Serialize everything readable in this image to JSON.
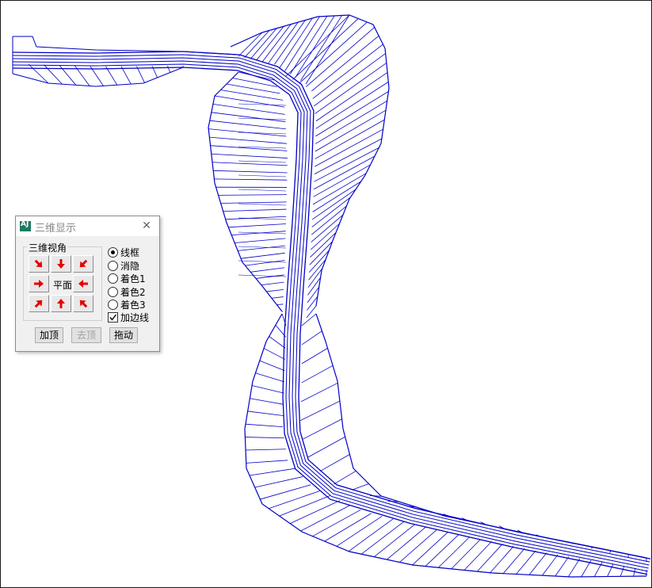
{
  "window": {
    "title": "三维显示",
    "app_icon": "app-icon",
    "close_glyph": "✕"
  },
  "view_group": {
    "label": "三维视角",
    "center_label": "平面",
    "arrows": [
      "arrow-down-right",
      "arrow-down",
      "arrow-down-left",
      "arrow-right",
      "arrow-left",
      "arrow-up-right",
      "arrow-up",
      "arrow-up-left"
    ]
  },
  "display_modes": [
    {
      "label": "线框",
      "selected": true
    },
    {
      "label": "消隐",
      "selected": false
    },
    {
      "label": "着色1",
      "selected": false
    },
    {
      "label": "着色2",
      "selected": false
    },
    {
      "label": "着色3",
      "selected": false
    }
  ],
  "edge_lines": {
    "label": "加边线",
    "checked": true
  },
  "buttons": {
    "add_top": "加顶",
    "remove_top": "去顶",
    "drag": "拖动"
  },
  "colors": {
    "wireframe": "#0000c8",
    "arrow": "#e60000",
    "icon": "#1e7a63"
  }
}
